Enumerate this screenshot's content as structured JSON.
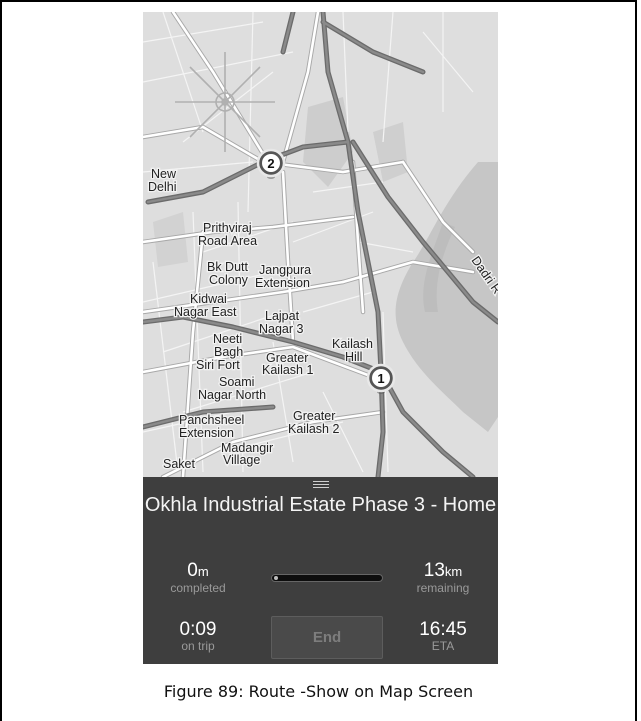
{
  "map": {
    "labels": {
      "new_delhi_1": "New",
      "new_delhi_2": "Delhi",
      "prithviraj_1": "Prithviraj",
      "prithviraj_2": "Road Area",
      "bkdutt_1": "Bk Dutt",
      "bkdutt_2": "Colony",
      "jangpura_1": "Jangpura",
      "jangpura_2": "Extension",
      "kidwai_1": "Kidwai",
      "kidwai_2": "Nagar East",
      "lajpat_1": "Lajpat",
      "lajpat_2": "Nagar 3",
      "neeti_1": "Neeti",
      "neeti_2": "Bagh",
      "kailashhill_1": "Kailash",
      "kailashhill_2": "Hill",
      "sirifort": "Siri Fort",
      "gk1_1": "Greater",
      "gk1_2": "Kailash 1",
      "soami_1": "Soami",
      "soami_2": "Nagar North",
      "panchsheel_1": "Panchsheel",
      "panchsheel_2": "Extension",
      "gk2_1": "Greater",
      "gk2_2": "Kailash 2",
      "madangir_1": "Madangir",
      "madangir_2": "Village",
      "saket": "Saket",
      "dadri": "Dadri R"
    },
    "waypoints": [
      "2",
      "1"
    ]
  },
  "panel": {
    "destination": "Okhla Industrial Estate Phase 3 - Home",
    "completed_value": "0",
    "completed_unit": "m",
    "completed_label": "completed",
    "remaining_value": "13",
    "remaining_unit": "km",
    "remaining_label": "remaining",
    "trip_time": "0:09",
    "trip_label": "on trip",
    "eta": "16:45",
    "eta_label": "ETA",
    "end_label": "End",
    "progress_fraction": 0.0
  },
  "caption": "Figure 89: Route -Show on Map Screen"
}
